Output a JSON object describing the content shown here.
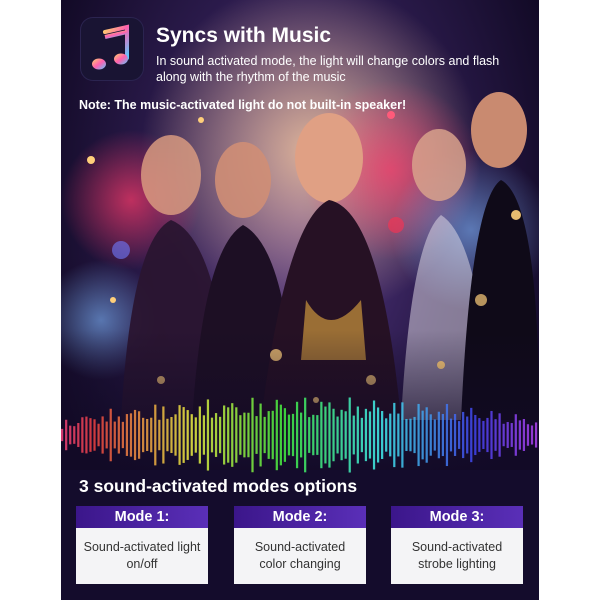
{
  "header": {
    "title": "Syncs with Music",
    "description": "In sound activated mode, the light will change colors and flash along with the rhythm of the music",
    "app_icon": "music-note-icon"
  },
  "note": "Note: The music-activated light do not built-in speaker!",
  "modes": {
    "title": "3 sound-activated modes options",
    "items": [
      {
        "label": "Mode 1:",
        "description": "Sound-activated light on/off"
      },
      {
        "label": "Mode 2:",
        "description": "Sound-activated color changing"
      },
      {
        "label": "Mode 3:",
        "description": "Sound-activated strobe lighting"
      }
    ]
  },
  "colors": {
    "accent": "#4a1fa8",
    "background": "#1a1036",
    "card_body": "#f4f4f6"
  }
}
